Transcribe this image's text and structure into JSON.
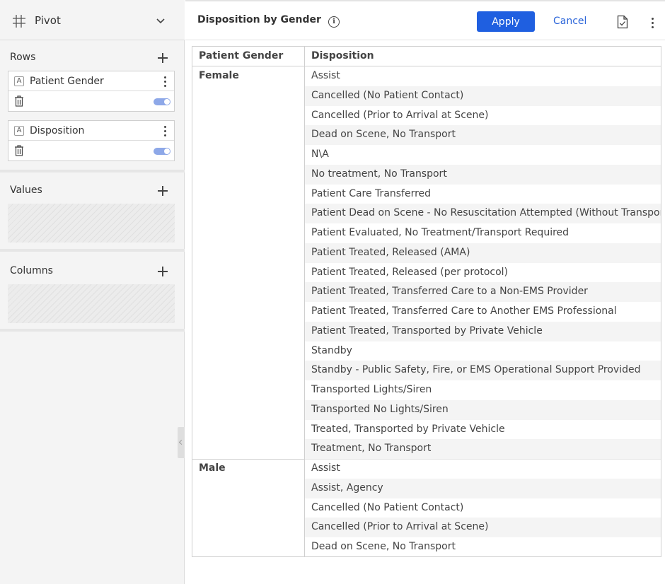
{
  "panel": {
    "title": "Pivot",
    "rows_label": "Rows",
    "values_label": "Values",
    "columns_label": "Columns",
    "row_fields": [
      {
        "label": "Patient Gender",
        "type_icon": "A"
      },
      {
        "label": "Disposition",
        "type_icon": "A"
      }
    ]
  },
  "header": {
    "title": "Disposition by Gender",
    "info_icon": "i",
    "apply_label": "Apply",
    "cancel_label": "Cancel"
  },
  "table": {
    "columns": [
      "Patient Gender",
      "Disposition"
    ],
    "groups": [
      {
        "label": "Female",
        "rows": [
          "Assist",
          "Cancelled (No Patient Contact)",
          "Cancelled (Prior to Arrival at Scene)",
          "Dead on Scene, No Transport",
          "N\\A",
          "No treatment, No Transport",
          "Patient Care Transferred",
          "Patient Dead on Scene - No Resuscitation Attempted (Without Transport)",
          "Patient Evaluated, No Treatment/Transport Required",
          "Patient Treated, Released (AMA)",
          "Patient Treated, Released (per protocol)",
          "Patient Treated, Transferred Care to a Non-EMS Provider",
          "Patient Treated, Transferred Care to Another EMS Professional",
          "Patient Treated, Transported by Private Vehicle",
          "Standby",
          "Standby - Public Safety, Fire, or EMS Operational Support Provided",
          "Transported Lights/Siren",
          "Transported No Lights/Siren",
          "Treated, Transported by Private Vehicle",
          "Treatment, No Transport"
        ]
      },
      {
        "label": "Male",
        "rows": [
          "Assist",
          "Assist, Agency",
          "Cancelled (No Patient Contact)",
          "Cancelled (Prior to Arrival at Scene)",
          "Dead on Scene, No Transport"
        ]
      }
    ]
  },
  "colors": {
    "accent": "#1f5fe0",
    "link": "#2a64d9",
    "toggle": "#8ea8e8"
  }
}
